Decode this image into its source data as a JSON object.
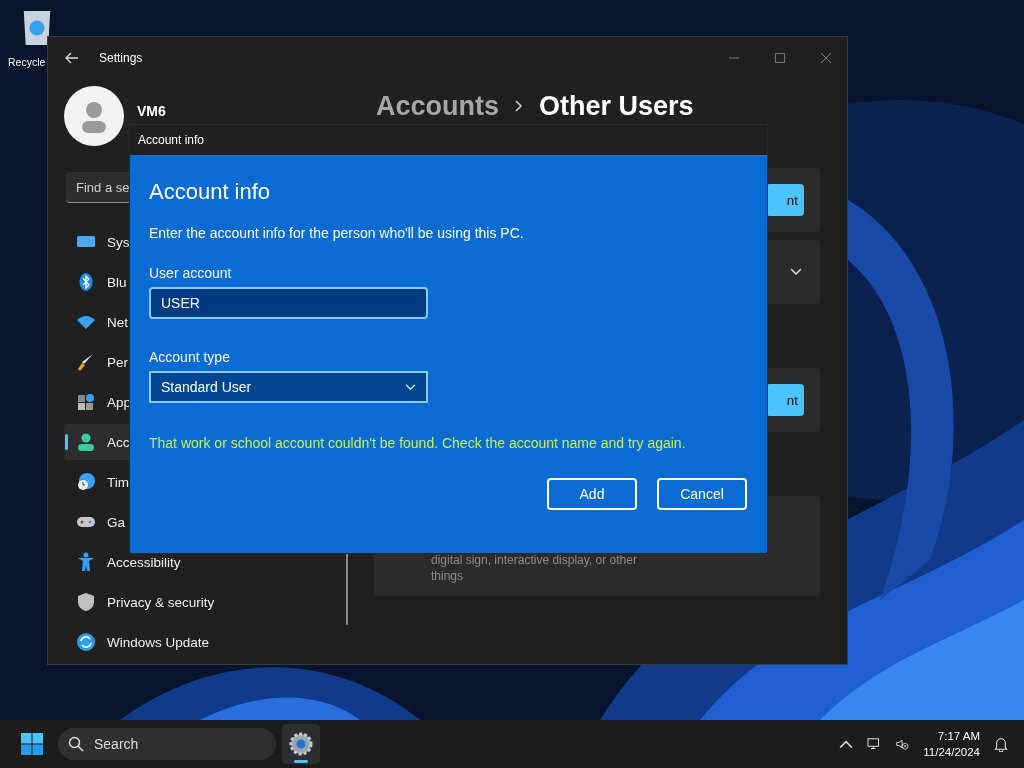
{
  "desktop": {
    "icons": [
      {
        "label": "Recycle"
      }
    ]
  },
  "settings_window": {
    "title": "Settings",
    "user": {
      "name": "VM6"
    },
    "search": {
      "placeholder": "Find a se"
    },
    "sidebar": {
      "items": [
        {
          "label": "Sys",
          "kind": "system",
          "selected": false
        },
        {
          "label": "Blu",
          "kind": "bluetooth",
          "selected": false
        },
        {
          "label": "Net",
          "kind": "network",
          "selected": false
        },
        {
          "label": "Per",
          "kind": "personalization",
          "selected": false
        },
        {
          "label": "App",
          "kind": "apps",
          "selected": false
        },
        {
          "label": "Acc",
          "kind": "accounts",
          "selected": true
        },
        {
          "label": "Tim",
          "kind": "time",
          "selected": false
        },
        {
          "label": "Ga",
          "kind": "gaming",
          "selected": false
        },
        {
          "label": "Accessibility",
          "kind": "accessibility",
          "selected": false
        },
        {
          "label": "Privacy & security",
          "kind": "privacy",
          "selected": false
        },
        {
          "label": "Windows Update",
          "kind": "update",
          "selected": false
        }
      ]
    },
    "breadcrumb": [
      "Accounts",
      "Other Users"
    ],
    "cards": [
      {
        "kind": "button",
        "button": "nt"
      },
      {
        "kind": "expander"
      },
      {
        "kind": "button",
        "button": "nt"
      },
      {
        "kind": "text",
        "text": "digital sign, interactive display, or other things"
      }
    ]
  },
  "dialog": {
    "title": "Account info",
    "heading": "Account info",
    "instructions": "Enter the account info for the person who'll be using this PC.",
    "user_account": {
      "label": "User account",
      "value": "USER"
    },
    "account_type": {
      "label": "Account type",
      "value": "Standard User"
    },
    "error": "That work or school account couldn't be found. Check the account name and try again.",
    "buttons": [
      "Add",
      "Cancel"
    ]
  },
  "taskbar": {
    "search": {
      "placeholder": "Search"
    },
    "apps": [
      {
        "kind": "settings",
        "active": true
      }
    ],
    "time": "7:17 AM",
    "date": "11/24/2024"
  }
}
